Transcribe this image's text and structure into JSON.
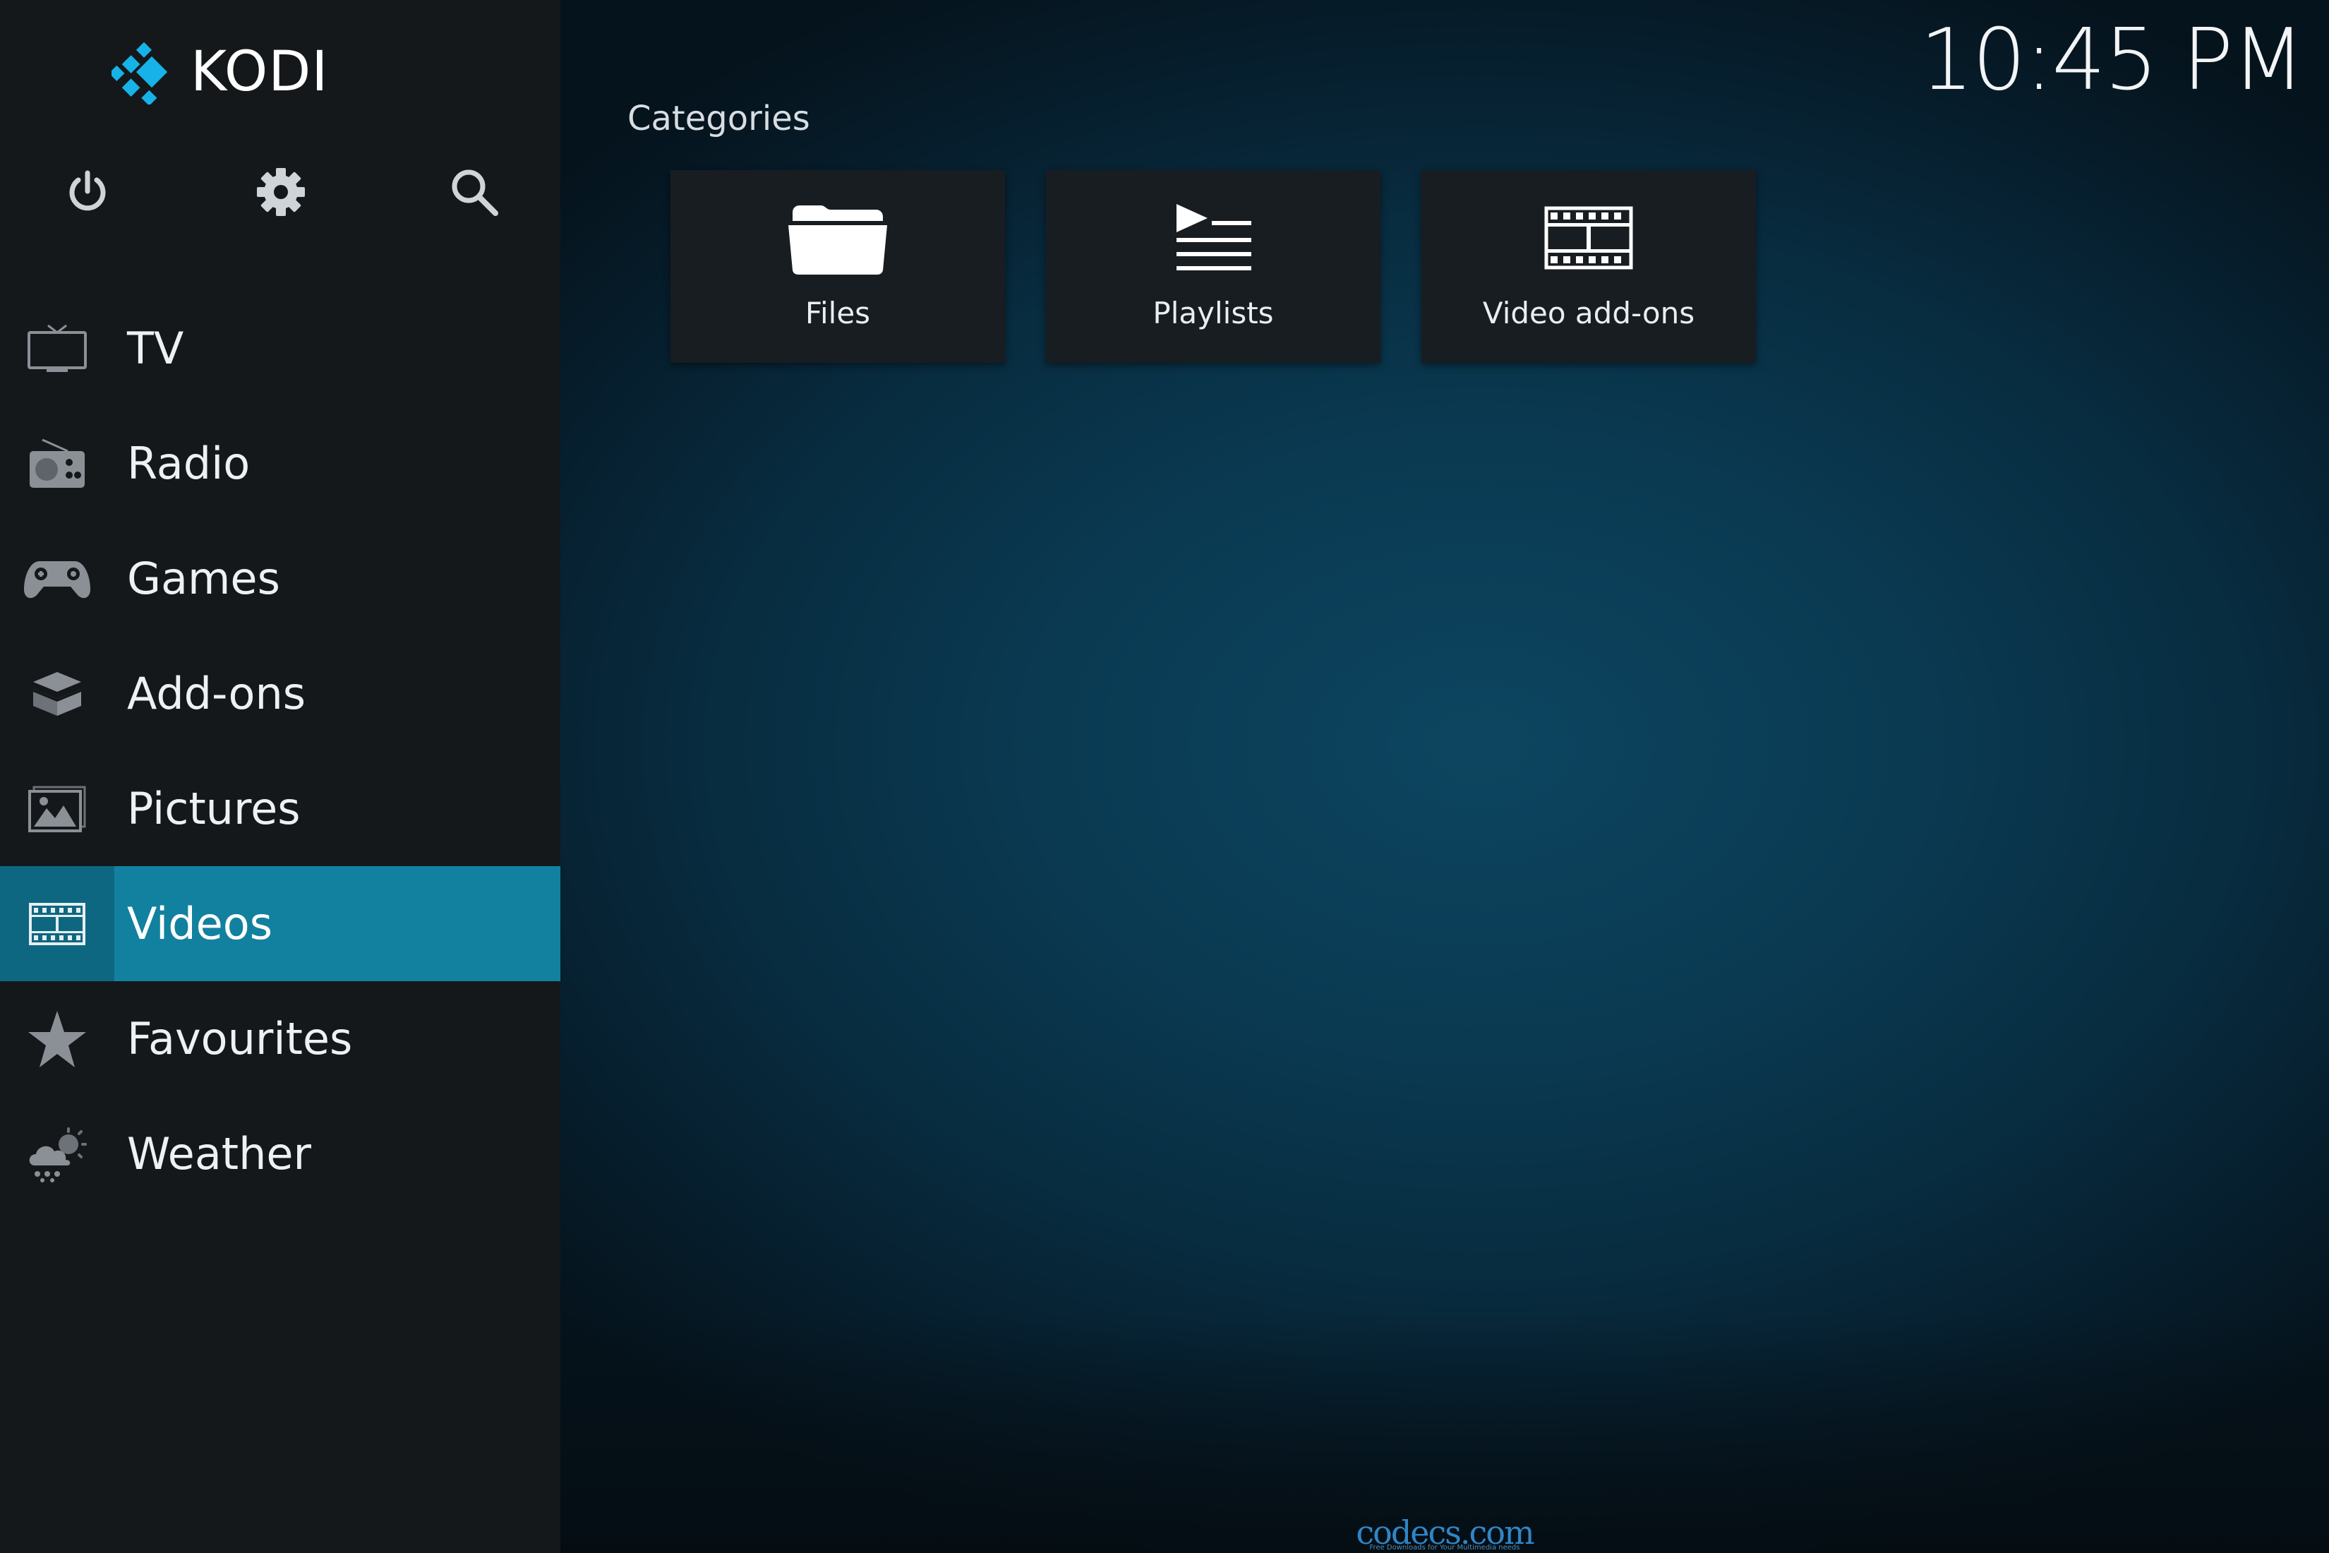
{
  "app": {
    "name": "KODI",
    "clock": "10:45 PM"
  },
  "toolbar": {
    "icons": [
      "power-icon",
      "gear-icon",
      "search-icon"
    ]
  },
  "sidebar": {
    "items": [
      {
        "label": "TV",
        "icon": "tv-icon"
      },
      {
        "label": "Radio",
        "icon": "radio-icon"
      },
      {
        "label": "Games",
        "icon": "gamepad-icon"
      },
      {
        "label": "Add-ons",
        "icon": "addons-box-icon"
      },
      {
        "label": "Pictures",
        "icon": "picture-icon"
      },
      {
        "label": "Videos",
        "icon": "film-icon",
        "active": true
      },
      {
        "label": "Favourites",
        "icon": "star-icon"
      },
      {
        "label": "Weather",
        "icon": "weather-icon"
      }
    ]
  },
  "main": {
    "section_title": "Categories",
    "tiles": [
      {
        "label": "Files",
        "icon": "folder-icon"
      },
      {
        "label": "Playlists",
        "icon": "playlist-icon"
      },
      {
        "label": "Video add-ons",
        "icon": "film-icon"
      }
    ]
  },
  "watermark": {
    "text": "codecs.com",
    "subtext": "Free Downloads for Your Multimedia needs"
  },
  "colors": {
    "accent": "#12819f",
    "accent_dark": "#0e6780",
    "sidebar_bg": "#15181b",
    "tile_bg": "#181d21",
    "logo_blue": "#17b2e7"
  }
}
